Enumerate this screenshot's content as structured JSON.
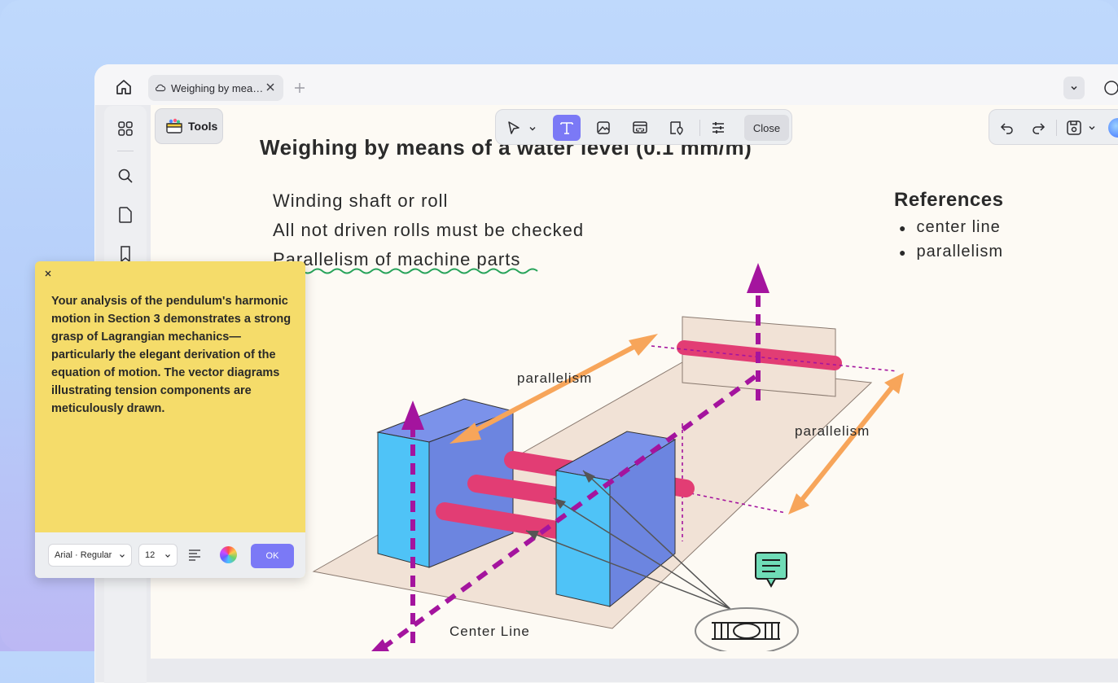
{
  "tabbar": {
    "tab_title": "Weighing by mea…"
  },
  "tools": {
    "label": "Tools"
  },
  "toolbar": {
    "close_label": "Close"
  },
  "document": {
    "title": "Weighing by means of a water level (0.1 mm/m)",
    "lines": [
      "Winding shaft or roll",
      "All not driven rolls must be checked",
      "Parallelism of machine parts"
    ],
    "references_title": "References",
    "references": [
      "center line",
      "parallelism"
    ],
    "labels": {
      "parallelism_top": "parallelism",
      "parallelism_right": "parallelism",
      "center_line": "Center Line"
    }
  },
  "note": {
    "text": "Your analysis of the pendulum's harmonic motion in Section 3 demonstrates a strong grasp of Lagrangian mechanics—particularly the elegant derivation of the equation of motion. The vector diagrams illustrating tension components are meticulously drawn.",
    "font": "Arial · Regular",
    "size": "12",
    "ok_label": "OK"
  },
  "colors": {
    "accent": "#7b79f6",
    "note_background": "#f5dc6a",
    "arrow_orange": "#f7a55a",
    "line_magenta": "#a4149e",
    "roll_pink": "#e23d74",
    "block_blue": "#4fc3f7"
  }
}
